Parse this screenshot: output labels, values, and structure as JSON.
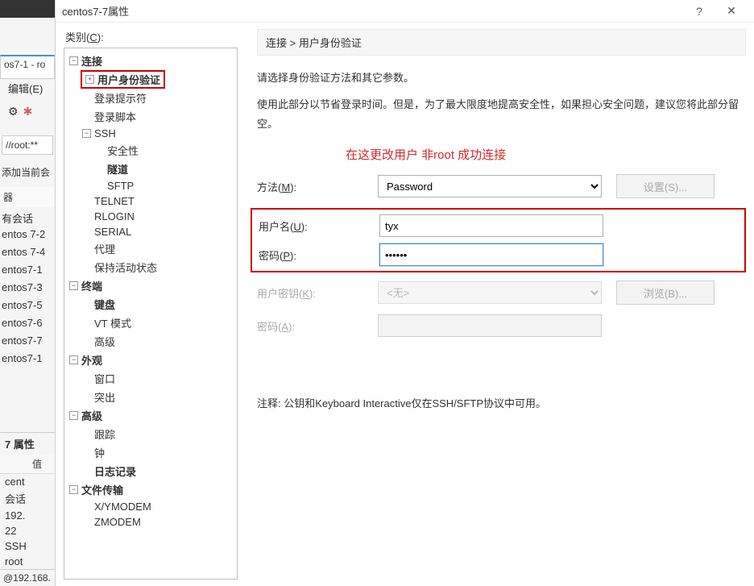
{
  "bg": {
    "title": "os7-1 - ro",
    "menu": "编辑(E)",
    "tab": "",
    "path": "//root:**",
    "add_dir": "添加当前会",
    "side_header": "器",
    "side_title": "有会话",
    "list": [
      "entos 7-2",
      "entos 7-4",
      "entos7-1",
      "entos7-3",
      "entos7-5",
      "entos7-6",
      "entos7-7",
      "entos7-1"
    ],
    "props_title": "7 属性",
    "col1": "值",
    "rows": [
      "cent",
      "会话",
      "192.",
      "22",
      "SSH",
      "root"
    ],
    "status": "@192.168."
  },
  "dialog": {
    "title": "centos7-7属性",
    "help": "?",
    "close": "✕",
    "cat_label_pre": "类别(",
    "cat_label_u": "C",
    "cat_label_post": "):",
    "tree": {
      "conn": "连接",
      "auth": "用户身份验证",
      "login_prompt": "登录提示符",
      "login_script": "登录脚本",
      "ssh": "SSH",
      "security": "安全性",
      "tunnel": "隧道",
      "sftp": "SFTP",
      "telnet": "TELNET",
      "rlogin": "RLOGIN",
      "serial": "SERIAL",
      "proxy": "代理",
      "keepalive": "保持活动状态",
      "terminal": "终端",
      "keyboard": "键盘",
      "vtmode": "VT 模式",
      "advanced_t": "高级",
      "appearance": "外观",
      "window": "窗口",
      "highlight": "突出",
      "advanced": "高级",
      "trace": "跟踪",
      "bell": "钟",
      "logging": "日志记录",
      "filetrans": "文件传输",
      "xymodem": "X/YMODEM",
      "zmodem": "ZMODEM"
    },
    "crumb_conn": "连接",
    "crumb_sep": " > ",
    "crumb_auth": "用户身份验证",
    "desc1": "请选择身份验证方法和其它参数。",
    "desc2": "使用此部分以节省登录时间。但是，为了最大限度地提高安全性，如果担心安全问题，建议您将此部分留空。",
    "annot": "在这更改用户  非root  成功连接",
    "method_label_pre": "方法(",
    "method_label_u": "M",
    "method_label_post": "):",
    "method_value": "Password",
    "setup_btn": "设置(S)...",
    "user_label_pre": "用户名(",
    "user_label_u": "U",
    "user_label_post": "):",
    "user_value": "tyx",
    "pass_label_pre": "密码(",
    "pass_label_u": "P",
    "pass_label_post": "):",
    "pass_value": "••••••",
    "ukey_label_pre": "用户密钥(",
    "ukey_label_u": "K",
    "ukey_label_post": "):",
    "ukey_value": "<无>",
    "browse_btn": "浏览(B)...",
    "pass2_label_pre": "密码(",
    "pass2_label_u": "A",
    "pass2_label_post": "):",
    "note": "注释: 公钥和Keyboard Interactive仅在SSH/SFTP协议中可用。"
  }
}
